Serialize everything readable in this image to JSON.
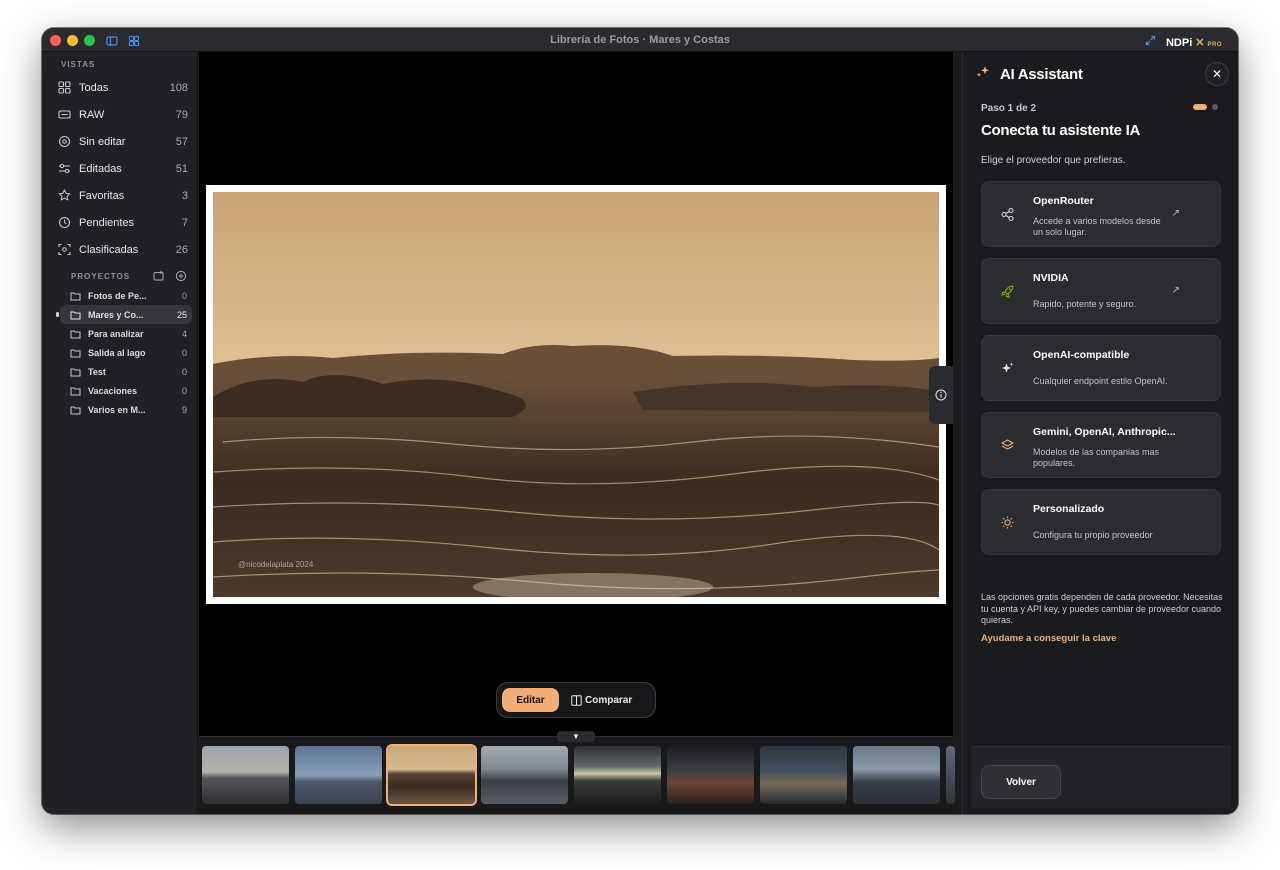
{
  "window": {
    "title": "Librería de Fotos · Mares y Costas",
    "brand": "NDPi",
    "brand_badge": "PRO"
  },
  "sidebar": {
    "views_label": "VISTAS",
    "views": [
      {
        "label": "Todas",
        "count": "108",
        "icon": "grid-icon"
      },
      {
        "label": "RAW",
        "count": "79",
        "icon": "raw-icon"
      },
      {
        "label": "Sin editar",
        "count": "57",
        "icon": "circle-icon"
      },
      {
        "label": "Editadas",
        "count": "51",
        "icon": "sliders-icon"
      },
      {
        "label": "Favoritas",
        "count": "3",
        "icon": "star-icon"
      },
      {
        "label": "Pendientes",
        "count": "7",
        "icon": "clock-icon"
      },
      {
        "label": "Clasificadas",
        "count": "26",
        "icon": "scan-icon"
      }
    ],
    "projects_label": "PROYECTOS",
    "projects": [
      {
        "label": "Fotos de Pe...",
        "count": "0"
      },
      {
        "label": "Mares y Co...",
        "count": "25",
        "active": true
      },
      {
        "label": "Para analizar",
        "count": "4"
      },
      {
        "label": "Salida al lago",
        "count": "0"
      },
      {
        "label": "Test",
        "count": "0"
      },
      {
        "label": "Vacaciones",
        "count": "0"
      },
      {
        "label": "Varios en M...",
        "count": "9"
      }
    ]
  },
  "viewer": {
    "watermark": "@nicodelaplata 2024",
    "edit_label": "Editar",
    "compare_label": "Comparar",
    "filmstrip_toggle": "▼",
    "thumb_count": 9,
    "selected_thumb": 2
  },
  "ai_panel": {
    "title": "AI Assistant",
    "close": "✕",
    "step": "Paso 1 de 2",
    "heading": "Conecta tu asistente IA",
    "subheading": "Elige el proveedor que prefieras.",
    "providers": [
      {
        "title": "OpenRouter",
        "desc": "Accede a varios modelos desde un solo lugar.",
        "icon": "share-icon",
        "external": true
      },
      {
        "title": "NVIDIA",
        "desc": "Rapido, potente y seguro.",
        "icon": "rocket-icon",
        "external": true
      },
      {
        "title": "OpenAI-compatible",
        "desc": "Cualquier endpoint estilo OpenAI.",
        "icon": "sparkles-icon",
        "external": false
      },
      {
        "title": "Gemini, OpenAI, Anthropic...",
        "desc": "Modelos de las companias mas populares.",
        "icon": "layers-icon",
        "external": false
      },
      {
        "title": "Personalizado",
        "desc": "Configura tu propio proveedor",
        "icon": "sun-icon",
        "external": false
      }
    ],
    "note": "Las opciones gratis dependen de cada proveedor. Necesitas tu cuenta y API key, y puedes cambiar de proveedor cuando quieras.",
    "help_link": "Ayudame a conseguir la clave",
    "back_label": "Volver"
  },
  "colors": {
    "accent": "#f1ae77",
    "panel_bg": "#1a1b1e",
    "sidebar_bg": "#202124"
  }
}
